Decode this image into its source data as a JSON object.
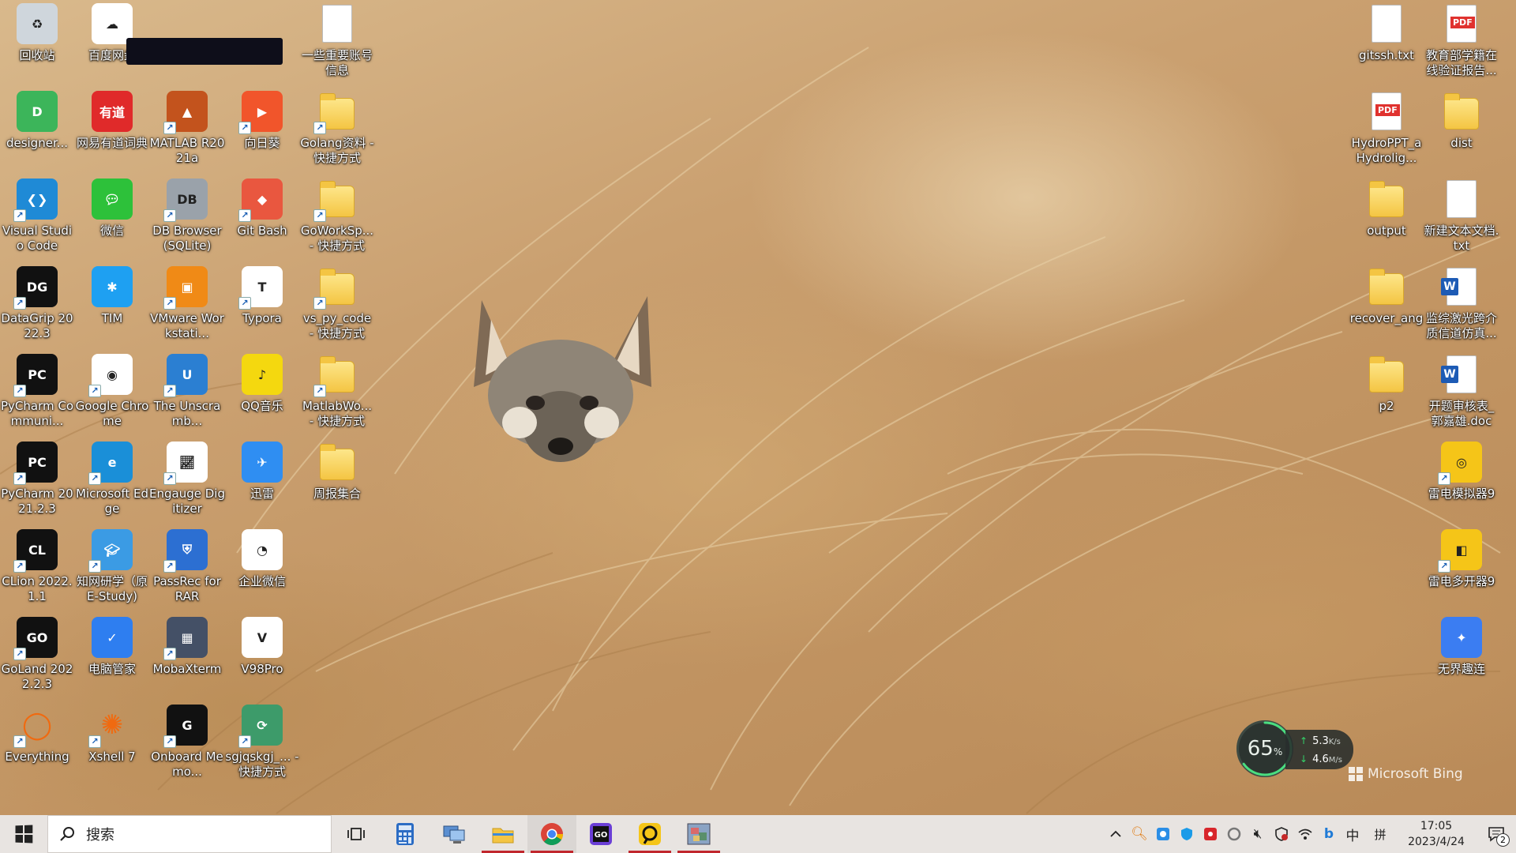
{
  "desktop": {
    "wallpaper": "golden grass with fox",
    "icons": [
      {
        "label": "回收站",
        "icon": "recycle-bin-icon"
      },
      {
        "label": "百度网盘",
        "icon": "baidu-netdisk-icon"
      },
      {
        "label": "一些重要账号信息",
        "icon": "text-file-icon"
      },
      {
        "label": "gitssh.txt",
        "icon": "text-file-icon"
      },
      {
        "label": "教育部学籍在线验证报告...",
        "icon": "pdf-file-icon"
      },
      {
        "label": "designer...",
        "icon": "designer-app-icon"
      },
      {
        "label": "网易有道词典",
        "icon": "youdao-dict-icon"
      },
      {
        "label": "MATLAB R2021a",
        "icon": "matlab-icon"
      },
      {
        "label": "向日葵",
        "icon": "sunlogin-icon"
      },
      {
        "label": "Golang资料 - 快捷方式",
        "icon": "folder-shortcut-icon"
      },
      {
        "label": "HydroPPT_a Hydrolig...",
        "icon": "pdf-file-icon"
      },
      {
        "label": "dist",
        "icon": "folder-icon"
      },
      {
        "label": "Visual Studio Code",
        "icon": "vscode-icon"
      },
      {
        "label": "微信",
        "icon": "wechat-icon"
      },
      {
        "label": "DB Browser (SQLite)",
        "icon": "db-browser-icon"
      },
      {
        "label": "Git Bash",
        "icon": "git-bash-icon"
      },
      {
        "label": "GoWorkSp... - 快捷方式",
        "icon": "folder-shortcut-icon"
      },
      {
        "label": "output",
        "icon": "folder-icon"
      },
      {
        "label": "新建文本文档.txt",
        "icon": "text-file-icon"
      },
      {
        "label": "DataGrip 2022.3",
        "icon": "datagrip-icon"
      },
      {
        "label": "TIM",
        "icon": "tim-icon"
      },
      {
        "label": "VMware Workstati...",
        "icon": "vmware-icon"
      },
      {
        "label": "Typora",
        "icon": "typora-icon"
      },
      {
        "label": "vs_py_code - 快捷方式",
        "icon": "folder-shortcut-icon"
      },
      {
        "label": "recover_ang",
        "icon": "folder-icon"
      },
      {
        "label": "监综激光跨介质信道仿真...",
        "icon": "word-doc-icon"
      },
      {
        "label": "PyCharm Communi...",
        "icon": "pycharm-icon"
      },
      {
        "label": "Google Chrome",
        "icon": "chrome-icon"
      },
      {
        "label": "The Unscramb...",
        "icon": "unscrambler-icon"
      },
      {
        "label": "QQ音乐",
        "icon": "qq-music-icon"
      },
      {
        "label": "MatlabWo... - 快捷方式",
        "icon": "folder-shortcut-icon"
      },
      {
        "label": "p2",
        "icon": "folder-icon"
      },
      {
        "label": "开题审核表_郭嘉雄.doc",
        "icon": "word-doc-icon"
      },
      {
        "label": "PyCharm 2021.2.3",
        "icon": "pycharm-icon"
      },
      {
        "label": "Microsoft Edge",
        "icon": "edge-icon"
      },
      {
        "label": "Engauge Digitizer",
        "icon": "engauge-icon"
      },
      {
        "label": "迅雷",
        "icon": "xunlei-icon"
      },
      {
        "label": "周报集合",
        "icon": "folder-icon"
      },
      {
        "label": "雷电模拟器9",
        "icon": "ldplayer-icon"
      },
      {
        "label": "CLion 2022.1.1",
        "icon": "clion-icon"
      },
      {
        "label": "知网研学（原E-Study)",
        "icon": "cnki-estudy-icon"
      },
      {
        "label": "PassRec for RAR",
        "icon": "passrec-icon"
      },
      {
        "label": "企业微信",
        "icon": "wecom-icon"
      },
      {
        "label": "雷电多开器9",
        "icon": "ldmulti-icon"
      },
      {
        "label": "GoLand 2022.2.3",
        "icon": "goland-icon"
      },
      {
        "label": "电脑管家",
        "icon": "pc-manager-icon"
      },
      {
        "label": "MobaXterm",
        "icon": "mobaxterm-icon"
      },
      {
        "label": "V98Pro",
        "icon": "v98pro-icon"
      },
      {
        "label": "无界趣连",
        "icon": "wujie-icon"
      },
      {
        "label": "Everything",
        "icon": "everything-icon"
      },
      {
        "label": "Xshell 7",
        "icon": "xshell-icon"
      },
      {
        "label": "Onboard Memo...",
        "icon": "onboard-memo-icon"
      },
      {
        "label": "sgjqskgj_... - 快捷方式",
        "icon": "shortcut-app-icon"
      }
    ]
  },
  "widget": {
    "cpu_percent": "65",
    "percent_sign": "%",
    "upload": "5.3",
    "upload_unit": "K/s",
    "download": "4.6",
    "download_unit": "M/s"
  },
  "watermark": "Microsoft Bing",
  "taskbar": {
    "search_placeholder": "搜索",
    "pinned": [
      {
        "name": "task-view",
        "active": false
      },
      {
        "name": "calculator",
        "active": false
      },
      {
        "name": "network-app",
        "active": false
      },
      {
        "name": "file-explorer",
        "active": true
      },
      {
        "name": "chrome",
        "active": true
      },
      {
        "name": "goland",
        "active": false
      },
      {
        "name": "ldplayer",
        "active": true
      },
      {
        "name": "image-app",
        "active": true
      }
    ],
    "tray": {
      "ime_lang": "中",
      "ime_mode": "拼",
      "time": "17:05",
      "date": "2023/4/24",
      "notifications": "2"
    }
  },
  "colors": {
    "taskbar_bg": "#e8e4e1",
    "active_indicator": "#c1272d",
    "widget_bg": "#2c3430",
    "widget_arrow": "#34d36a"
  }
}
